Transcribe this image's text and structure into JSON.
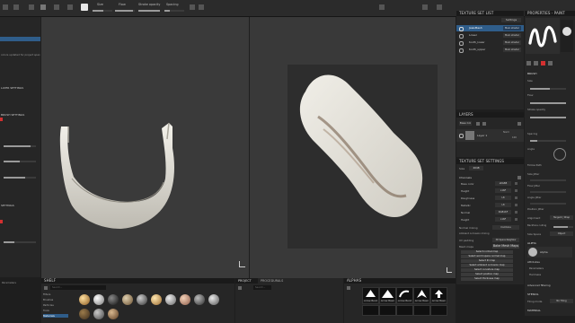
{
  "toolbar": {
    "size_label": "Size",
    "flow_label": "Flow",
    "stroke_opacity_label": "Stroke opacity",
    "spacing_label": "Spacing"
  },
  "texture_set_list": {
    "title": "TEXTURE SET LIST",
    "settings_label": "Settings",
    "items": [
      {
        "name": "JawsMesh",
        "shader": "Main shader"
      },
      {
        "name": "Lower",
        "shader": "Main shader"
      },
      {
        "name": "tooth_lower",
        "shader": "Main shader"
      },
      {
        "name": "tooth_upper",
        "shader": "Main shader"
      }
    ]
  },
  "layers": {
    "title": "LAYERS",
    "mode": "Base Col",
    "layer_name": "Layer 1",
    "blend": "Norm",
    "opacity": "100"
  },
  "texture_set_settings": {
    "title": "TEXTURE SET SETTINGS",
    "size_label": "Size",
    "size_value": "2048",
    "channels_label": "Channels",
    "channels": [
      {
        "name": "Base color",
        "format": "sRGB8"
      },
      {
        "name": "Height",
        "format": "L16F"
      },
      {
        "name": "Roughness",
        "format": "L8"
      },
      {
        "name": "Metallic",
        "format": "L8"
      },
      {
        "name": "Normal",
        "format": "RGB16F"
      },
      {
        "name": "Height",
        "format": "L16F"
      }
    ],
    "normal_mixing_label": "Normal mixing",
    "normal_mixing_value": "Combine",
    "ao_mixing_label": "Ambient occlusion mixing",
    "uv_padding_label": "UV padding",
    "uv_padding_value": "3D Space Neighbor",
    "mesh_maps_label": "Mesh maps",
    "bake_button": "Bake Mesh Maps",
    "select_buttons": [
      "Select normal map",
      "Select world space normal map",
      "Select ID map",
      "Select ambient occlusion map",
      "Select curvature map",
      "Select position map",
      "Select thickness map"
    ]
  },
  "properties": {
    "title": "PROPERTIES - PAINT",
    "brush_section": "BRUSH",
    "size_label": "Size",
    "flow_label": "Flow",
    "stroke_opacity_label": "Stroke opacity",
    "spacing_label": "Spacing",
    "angle_label": "Angle",
    "follow_path_label": "Follow Path",
    "size_jitter_label": "Size Jitter",
    "flow_jitter_label": "Flow Jitter",
    "angle_jitter_label": "Angle Jitter",
    "position_jitter_label": "Position Jitter",
    "alignment_label": "Alignment",
    "alignment_value": "Tangent | Wrap",
    "backface_culling_label": "Backface culling",
    "size_space_label": "Size Space",
    "size_space_value": "Object",
    "alpha_section": "ALPHA",
    "alpha_name": "Alpha",
    "attributes_label": "Attributes",
    "parameters_label": "Parameters",
    "hardness_label": "Hardness",
    "advanced_label": "Advanced filtering",
    "stencil_section": "STENCIL",
    "tiling_mode_label": "Tiling mode",
    "tiling_mode_value": "No Tiling",
    "material_section": "MATERIAL"
  },
  "left_panel": {
    "section_labels": [
      "LAYER SETTINGS",
      "BRUSH SETTINGS",
      "SETTINGS"
    ],
    "text_lines": [
      "colors updated for project space",
      "Parameters",
      "ByLayer"
    ]
  },
  "bottom": {
    "shelf_title": "SHELF",
    "shelf_categories": [
      "Filters",
      "Brushes",
      "Particles",
      "Tools",
      "Materials"
    ],
    "project_title": "PROJECT",
    "procedurals_title": "PROCEDURALS",
    "search_placeholder": "Search...",
    "alphas_title": "ALPHAS",
    "alphas": [
      "Arrow Bend",
      "Arrow Basic",
      "Arrow Bend",
      "Arrow Basic",
      "Arrow Basic",
      "Arrow Basic",
      "Arrow Basic"
    ]
  },
  "colors": {
    "accent_red": "#d33030",
    "selection_blue": "#2f5d8a",
    "viewport_bg": "#393939"
  }
}
